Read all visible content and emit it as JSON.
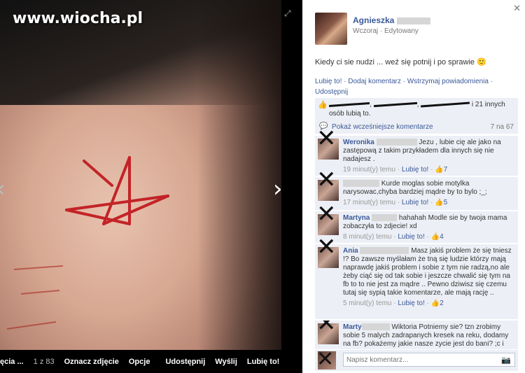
{
  "watermark": "www.wiocha.pl",
  "photo_bar": {
    "album": "ęcia ...",
    "counter": "1 z 83",
    "tag": "Oznacz zdjęcie",
    "options": "Opcje",
    "share": "Udostępnij",
    "send": "Wyślij",
    "like": "Lubię to!"
  },
  "post": {
    "author": "Agnieszka",
    "meta": "Wczoraj · Edytowany",
    "text": "Kiedy ci sie nudzi ... weź się potnij i po sprawie 🙂",
    "actions": "Lubię to! · Dodaj komentarz · Wstrzymaj powiadomienia · Udostępnij",
    "likes_suffix": "i 21 innych osób lubią to.",
    "earlier": "Pokaż wcześniejsze komentarze",
    "earlier_count": "7 na 67"
  },
  "comments": [
    {
      "name": "Weronika",
      "text": "Jezu , lubie cię ale jako na zastępową z takim przykładem dla innych się nie nadajesz .",
      "time": "19 minut(y) temu",
      "like": "Lubię to!",
      "likes": "7"
    },
    {
      "name": "",
      "text": "Kurde moglas sobie motylka narysowac,chyba bardziej mądre by to bylo ;_;",
      "time": "17 minut(y) temu",
      "like": "Lubię to!",
      "likes": "5"
    },
    {
      "name": "Martyna",
      "text": "hahahah Modle sie by twoja mama zobaczyła to zdjecie! xd",
      "time": "8 minut(y) temu",
      "like": "Lubię to!",
      "likes": "4"
    },
    {
      "name": "Ania",
      "text": "Masz jakiś problem że się tniesz !? Bo zawsze myślałam że tną się ludzie którzy mają naprawdę jakiś problem i sobie z tym nie radzą,no ale żeby ciąć się od tak sobie i jeszcze chwalić się tym na fb to to nie jest za mądre .. Pewno dziwisz się czemu tutaj się sypią takie komentarze, ale mają rację ..",
      "time": "5 minut(y) temu",
      "like": "Lubię to!",
      "likes": "2"
    },
    {
      "name": "Marty",
      "text": "Wiktoria Potniemy sie? tzn zrobimy sobie 5 malych zadrapanych kresek na reku, dodamy na fb? pokażemy jakie nasze zycie jest do bani? ;c i",
      "time": "",
      "like": "",
      "likes": ""
    }
  ],
  "reply": {
    "placeholder": "Napisz komentarz..."
  }
}
